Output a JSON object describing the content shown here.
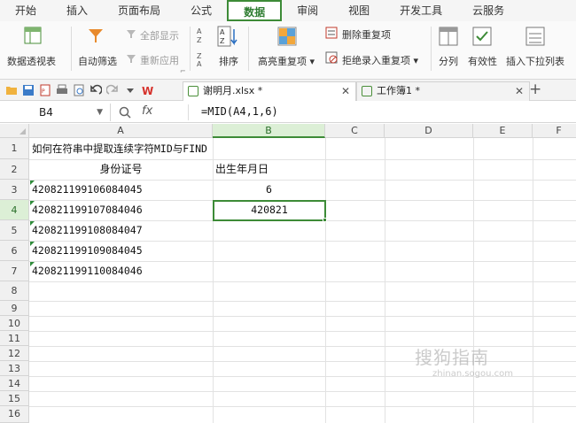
{
  "menu": {
    "tabs": [
      "开始",
      "插入",
      "页面布局",
      "公式",
      "数据",
      "审阅",
      "视图",
      "开发工具",
      "云服务"
    ],
    "active_index": 4
  },
  "ribbon": {
    "pivot": "数据透视表",
    "autofilter": "自动筛选",
    "show_all": "全部显示",
    "reapply": "重新应用",
    "sort": "排序",
    "highlight_dup": "高亮重复项",
    "remove_dup": "删除重复项",
    "reject_dup": "拒绝录入重复项",
    "split": "分列",
    "validity": "有效性",
    "dropdown": "插入下拉列表",
    "corner_mark": "⌐"
  },
  "quickbar": {
    "doc_tabs": [
      {
        "label": "谢明月.xlsx *"
      },
      {
        "label": "工作簿1 *"
      }
    ],
    "add_tab": "+"
  },
  "formula_bar": {
    "name_box": "B4",
    "fx": "fx",
    "formula": "=MID(A4,1,6)"
  },
  "columns": [
    "A",
    "B",
    "C",
    "D",
    "E",
    "F"
  ],
  "rows": [
    "1",
    "2",
    "3",
    "4",
    "5",
    "6",
    "7",
    "8",
    "9",
    "10",
    "11",
    "12",
    "13",
    "14",
    "15",
    "16"
  ],
  "cells": {
    "A1": "如何在符串中提取连续字符MID与FIND",
    "A2": "身份证号",
    "B2": "出生年月日",
    "A3": "420821199106084045",
    "B3": "6",
    "A4": "420821199107084046",
    "B4": "420821",
    "A5": "420821199108084047",
    "A6": "420821199109084045",
    "A7": "420821199110084046"
  },
  "watermark": {
    "line1": "搜狗指南",
    "line2": "zhinan.sogou.com"
  },
  "colors": {
    "accent_green": "#3d8b37",
    "active_tab": "#2f7d32"
  }
}
